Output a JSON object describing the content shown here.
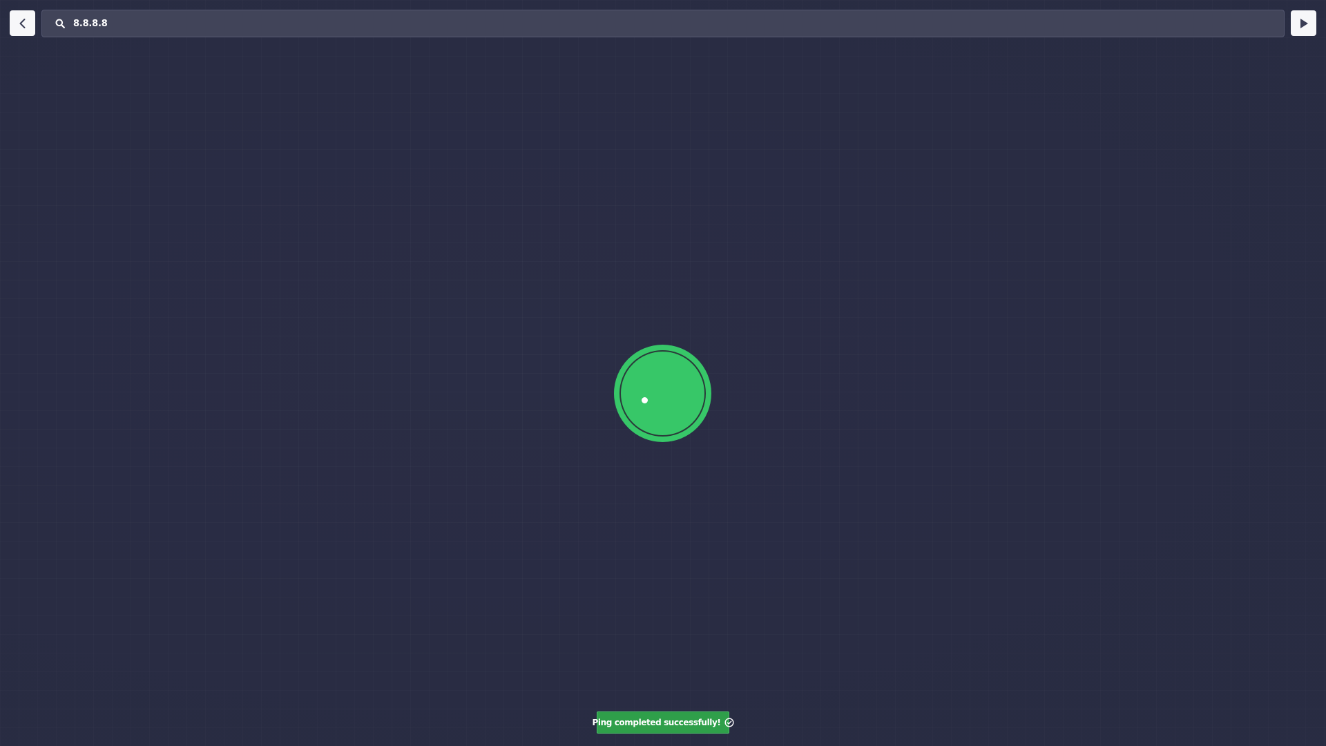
{
  "toolbar": {
    "back_icon": "chevron-left-icon",
    "run_icon": "play-icon"
  },
  "search": {
    "icon": "search-icon",
    "value": "8.8.8.8"
  },
  "status": {
    "state": "success",
    "color": "#37c768"
  },
  "toast": {
    "message": "Ping completed successfully!",
    "icon": "check-circle-icon",
    "color": "#2f9f4a"
  },
  "colors": {
    "background": "#2a2d45",
    "search_background": "#414459",
    "button_background": "#f7f7f9"
  }
}
